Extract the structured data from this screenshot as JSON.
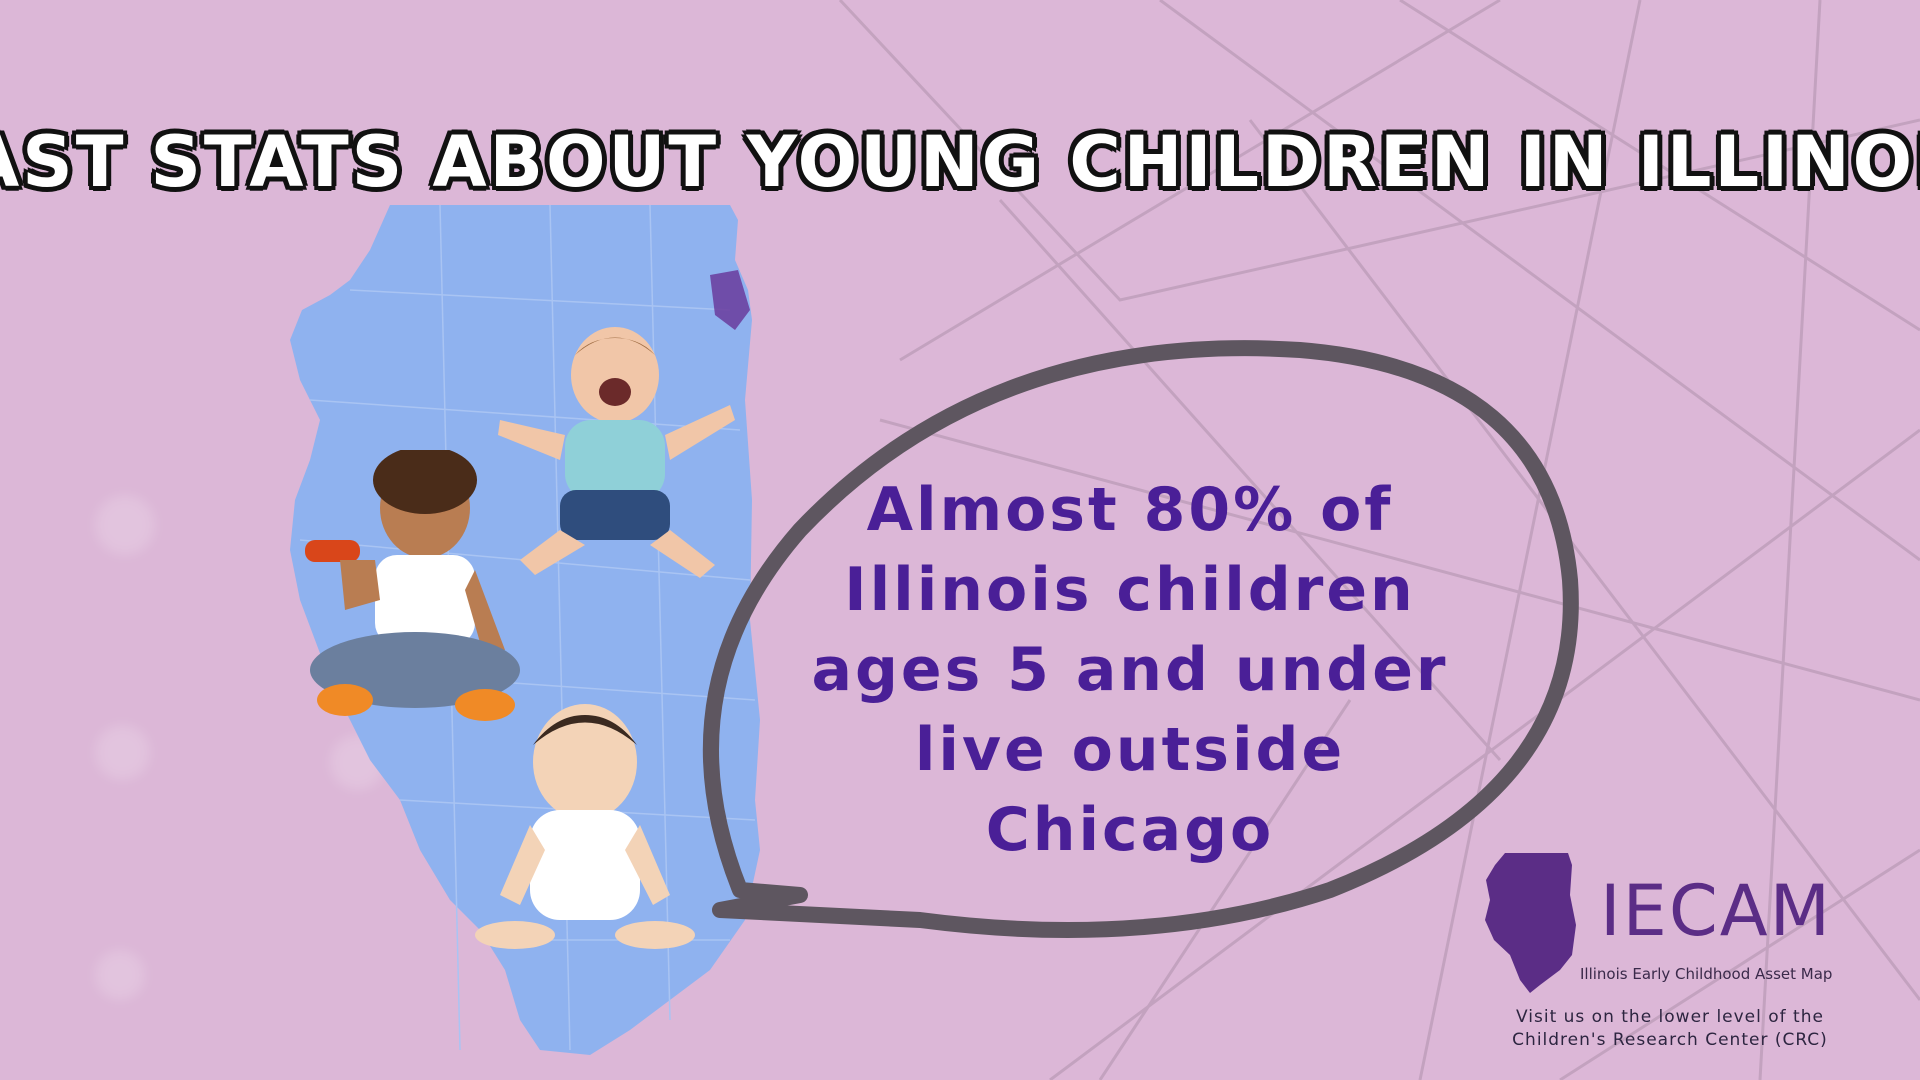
{
  "title": {
    "left": "FAST",
    "right": "STATS ABOUT YOUNG CHILDREN IN ILLINOIS"
  },
  "message": {
    "lines": [
      "Almost 80% of",
      "Illinois children",
      "ages 5 and under",
      "live outside",
      "Chicago"
    ]
  },
  "logo": {
    "wordmark": "IECAM",
    "subtitle": "Illinois Early Childhood Asset Map"
  },
  "footer": {
    "lines": [
      "Visit us on the lower level of the",
      "Children's Research Center (CRC)"
    ]
  },
  "colors": {
    "background": "#dcb7d7",
    "map": "#8fb2ef",
    "message_text": "#4a1f97",
    "bubble_outline": "#5e5660",
    "logo": "#5b2d86",
    "bolt": "#f2e63b"
  },
  "icons": [
    "lightning-bolt-icon",
    "illinois-map",
    "iecam-logo-icon"
  ]
}
